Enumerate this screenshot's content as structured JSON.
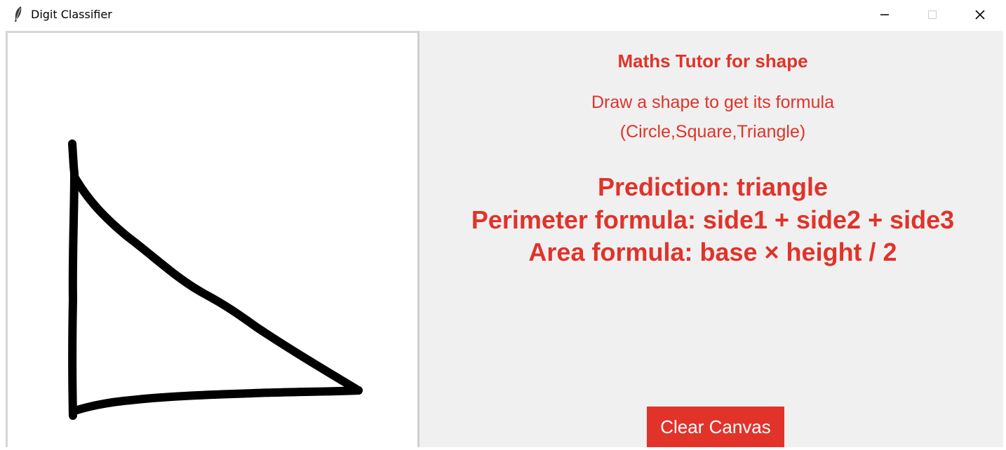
{
  "window": {
    "title": "Digit Classifier",
    "controls": [
      "minimize",
      "maximize",
      "close"
    ]
  },
  "canvas": {
    "drawn_shape": "triangle",
    "stroke_color": "#000000",
    "background": "#ffffff"
  },
  "panel": {
    "title": "Maths Tutor for shape",
    "instruction": "Draw a shape to get its formula",
    "shapes": "(Circle,Square,Triangle)",
    "prediction": "Prediction: triangle",
    "perimeter": "Perimeter formula: side1 + side2 + side3",
    "area": "Area formula: base × height / 2",
    "text_color": "#e0332a"
  },
  "clear_button": {
    "label": "Clear Canvas",
    "bg_color": "#e2332a"
  },
  "icons": {
    "app": "feather-icon",
    "minimize": "minimize-icon",
    "maximize": "maximize-icon",
    "close": "close-icon"
  }
}
